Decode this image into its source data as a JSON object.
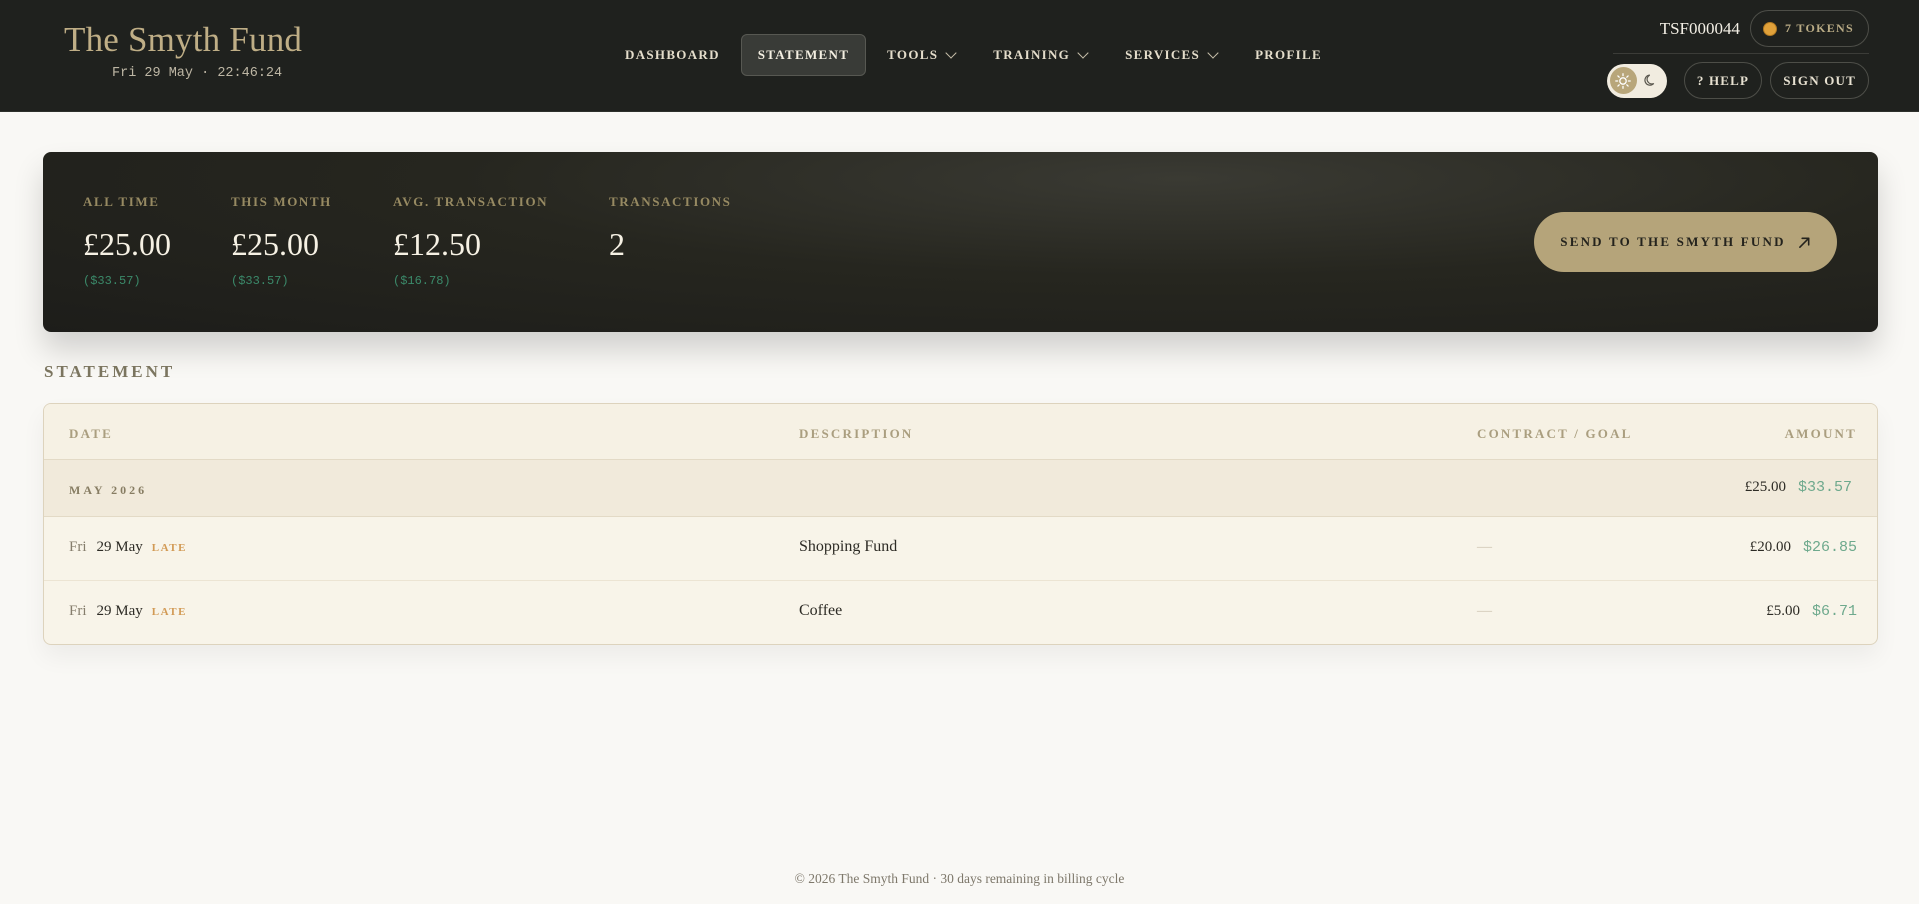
{
  "header": {
    "brand": "The Smyth Fund",
    "clock": "Fri 29 May · 22:46:24",
    "nav": [
      {
        "label": "DASHBOARD"
      },
      {
        "label": "STATEMENT"
      },
      {
        "label": "TOOLS"
      },
      {
        "label": "TRAINING"
      },
      {
        "label": "SERVICES"
      },
      {
        "label": "PROFILE"
      }
    ],
    "account_id": "TSF000044",
    "tokens": "7 TOKENS",
    "help": "? HELP",
    "sign_out": "SIGN OUT"
  },
  "summary": {
    "stats": [
      {
        "label": "ALL TIME",
        "value": "£25.00",
        "sub": "($33.57)"
      },
      {
        "label": "THIS MONTH",
        "value": "£25.00",
        "sub": "($33.57)"
      },
      {
        "label": "AVG. TRANSACTION",
        "value": "£12.50",
        "sub": "($16.78)"
      },
      {
        "label": "TRANSACTIONS",
        "value": "2",
        "sub": ""
      }
    ],
    "send_button": "SEND TO THE SMYTH FUND"
  },
  "statement": {
    "title": "STATEMENT",
    "columns": {
      "date": "DATE",
      "description": "DESCRIPTION",
      "goal": "CONTRACT / GOAL",
      "amount": "AMOUNT"
    },
    "group": {
      "label": "MAY 2026",
      "gbp": "£25.00",
      "usd": "$33.57"
    },
    "rows": [
      {
        "dow": "Fri",
        "date": "29 May",
        "badge": "LATE",
        "description": "Shopping Fund",
        "goal": "—",
        "gbp": "£20.00",
        "usd": "$26.85"
      },
      {
        "dow": "Fri",
        "date": "29 May",
        "badge": "LATE",
        "description": "Coffee",
        "goal": "—",
        "gbp": "£5.00",
        "usd": "$6.71"
      }
    ]
  },
  "footer": "© 2026 The Smyth Fund · 30 days remaining in billing cycle",
  "colors": {
    "accent": "#b5a47a",
    "header_bg": "#1f211e",
    "usd": "#6ea98d",
    "late": "#d29a55"
  },
  "icons": {
    "theme_light": "sun-icon",
    "theme_dark": "moon-icon",
    "token": "coin-icon",
    "send": "arrow-up-right-icon",
    "dropdown": "chevron-down-icon"
  }
}
